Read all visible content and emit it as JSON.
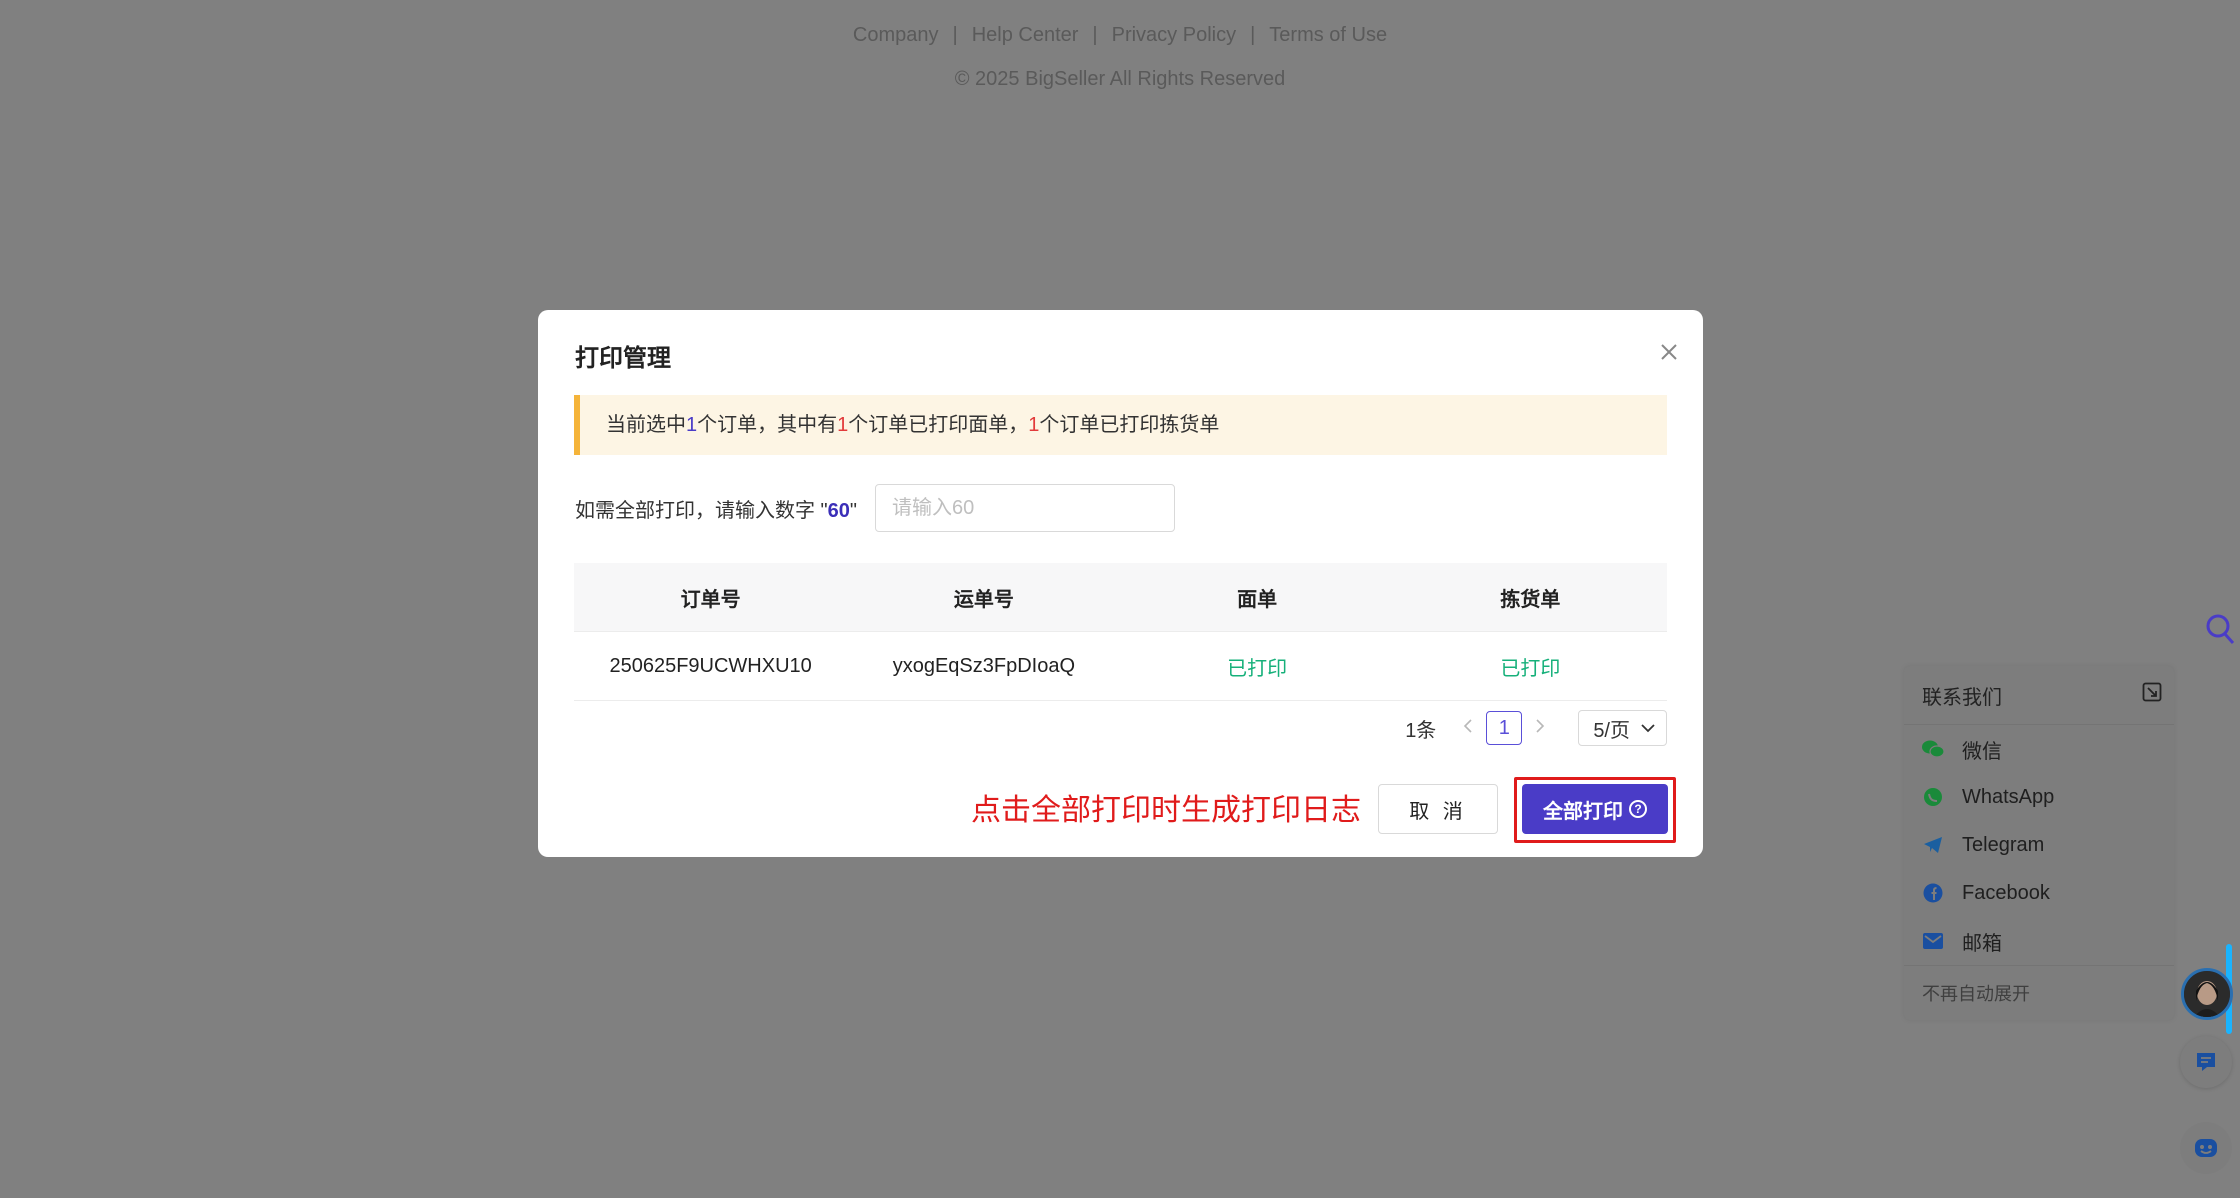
{
  "footer": {
    "links": [
      "Company",
      "Help Center",
      "Privacy Policy",
      "Terms of Use"
    ],
    "separator": "|",
    "copyright": "© 2025 BigSeller All Rights Reserved"
  },
  "modal": {
    "title": "打印管理",
    "notice": {
      "p1": "当前选中",
      "n1": "1",
      "p2": "个订单，其中有",
      "n2": "1",
      "p3": "个订单已打印面单，",
      "n3": "1",
      "p4": "个订单已打印拣货单"
    },
    "confirm": {
      "label_prefix": "如需全部打印，请输入数字 \"",
      "number": "60",
      "label_suffix": "\"",
      "placeholder": "请输入60"
    },
    "table": {
      "headers": [
        "订单号",
        "运单号",
        "面单",
        "拣货单"
      ],
      "rows": [
        {
          "order_no": "250625F9UCWHXU10",
          "tracking_no": "yxogEqSz3FpDIoaQ",
          "waybill": "已打印",
          "picking": "已打印"
        }
      ]
    },
    "pagination": {
      "total": "1条",
      "current_page": "1",
      "page_size": "5/页"
    },
    "annotation": "点击全部打印时生成打印日志",
    "cancel_label": "取 消",
    "print_all_label": "全部打印"
  },
  "contact": {
    "title": "联系我们",
    "items": [
      {
        "label": "微信",
        "icon": "wechat-icon"
      },
      {
        "label": "WhatsApp",
        "icon": "whatsapp-icon"
      },
      {
        "label": "Telegram",
        "icon": "telegram-icon"
      },
      {
        "label": "Facebook",
        "icon": "facebook-icon"
      },
      {
        "label": "邮箱",
        "icon": "mail-icon"
      }
    ],
    "footer": "不再自动展开"
  },
  "colors": {
    "primary": "#4a3cc7",
    "success": "#16b07a",
    "annotation_red": "#e01b1b",
    "warning_border": "#f5b43a"
  }
}
